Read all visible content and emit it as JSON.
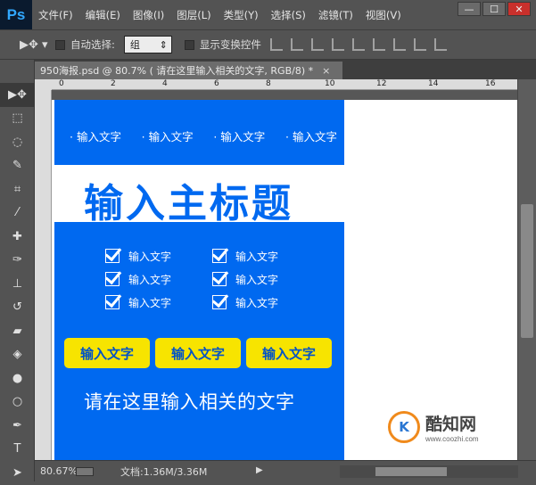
{
  "menubar": {
    "logo": "Ps",
    "items": [
      "文件(F)",
      "编辑(E)",
      "图像(I)",
      "图层(L)",
      "类型(Y)",
      "选择(S)",
      "滤镜(T)",
      "视图(V)"
    ],
    "min": "—",
    "max": "☐",
    "close": "✕"
  },
  "options": {
    "tool_glyph": "▶✥ ▾",
    "auto_select_label": "自动选择:",
    "auto_select_value": "组",
    "show_transform_label": "显示变换控件"
  },
  "tab": {
    "title": "950海报.psd @ 80.7% (     请在这里输入相关的文字, RGB/8) *",
    "close": "×"
  },
  "ruler": {
    "labels": [
      "0",
      "2",
      "4",
      "6",
      "8",
      "10",
      "12",
      "14",
      "16"
    ]
  },
  "poster": {
    "top_items": [
      "· 输入文字",
      "· 输入文字",
      "· 输入文字",
      "· 输入文字"
    ],
    "headline": "输入主标题",
    "checks_left": [
      "输入文字",
      "输入文字",
      "输入文字"
    ],
    "checks_right": [
      "输入文字",
      "输入文字",
      "输入文字"
    ],
    "buttons": [
      "输入文字",
      "输入文字",
      "输入文字"
    ],
    "bottom_text": "请在这里输入相关的文字",
    "colors": {
      "blue": "#0069f0",
      "yellow": "#f7e400"
    }
  },
  "watermark": {
    "logo": "K",
    "title": "酷知网",
    "url": "www.coozhi.com"
  },
  "status": {
    "zoom": "80.67%",
    "doc": "文档:1.36M/3.36M",
    "arrow": "▶"
  },
  "tools": [
    "move-tool",
    "marquee-tool",
    "lasso-tool",
    "quick-select-tool",
    "crop-tool",
    "eyedropper-tool",
    "healing-tool",
    "brush-tool",
    "stamp-tool",
    "history-brush-tool",
    "eraser-tool",
    "paint-bucket-tool",
    "blur-tool",
    "dodge-tool",
    "pen-tool",
    "type-tool",
    "path-select-tool"
  ]
}
